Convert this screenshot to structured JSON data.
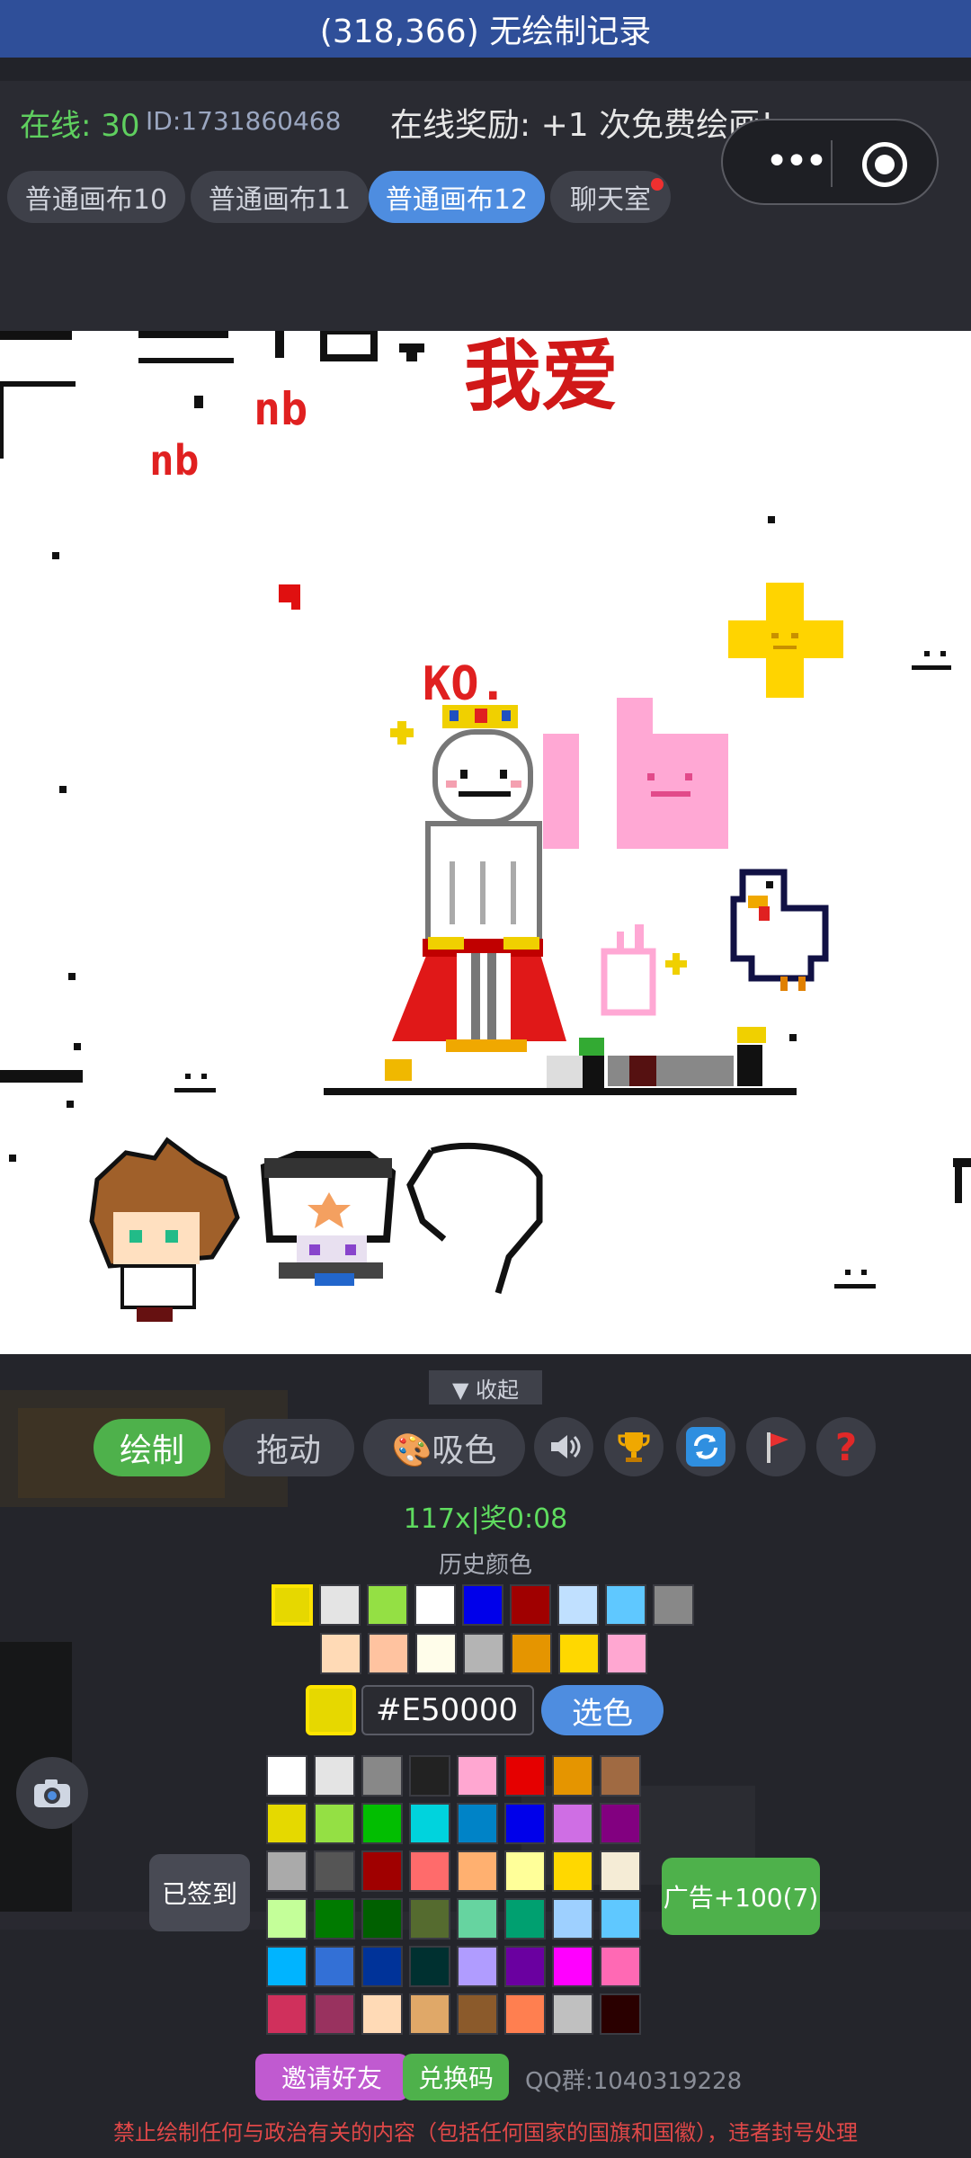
{
  "title": "(318,366) 无绘制记录",
  "info": {
    "online": "在线: 30",
    "user_id": "ID:1731860468",
    "reward": "在线奖励: +1 次免费绘画!"
  },
  "capsule": {
    "more": "•••"
  },
  "tabs": [
    {
      "label": "普通画布10",
      "active": false
    },
    {
      "label": "普通画布11",
      "active": false
    },
    {
      "label": "普通画布12",
      "active": true
    },
    {
      "label": "聊天室",
      "active": false
    }
  ],
  "canvas_text": {
    "nb1": "nb",
    "nb2": "nb",
    "woai": "我爱",
    "ko": "KO."
  },
  "panel": {
    "collapse": "▼ 收起",
    "tools": {
      "draw": "绘制",
      "drag": "拖动",
      "eyedropper": "🎨吸色"
    },
    "icons": [
      "sound-icon",
      "trophy-icon",
      "refresh-icon",
      "flag-icon",
      "help-icon"
    ],
    "timer": "117x|奖0:08",
    "history_title": "历史颜色",
    "history_colors_row1": [
      "#e6d800",
      "#e4e4e4",
      "#94e044",
      "#ffffff",
      "#0000ea",
      "#a00000",
      "#c0e0ff",
      "#5fc8ff",
      "#888888"
    ],
    "history_colors_row2": [
      "#ffdab6",
      "#ffc3a0",
      "#fffdea",
      "#b4b4b4",
      "#e59500",
      "#ffd800",
      "#ffa7d1"
    ],
    "current_color": "#e6d800",
    "hex_value": "#E50000",
    "pick_label": "选色",
    "palette": [
      [
        "#ffffff",
        "#e4e4e4",
        "#888888",
        "#222222",
        "#ffa7d1",
        "#e50000",
        "#e59500",
        "#a06a42"
      ],
      [
        "#e5d900",
        "#94e044",
        "#02be01",
        "#00d3dd",
        "#0083c7",
        "#0000ea",
        "#cf6ee4",
        "#820080"
      ],
      [
        "#aaaaaa",
        "#555555",
        "#a00000",
        "#ff6b6b",
        "#ffb070",
        "#ffff99",
        "#ffd800",
        "#f5ecd6"
      ],
      [
        "#c4ff99",
        "#007a00",
        "#006000",
        "#556b2f",
        "#66d4a0",
        "#00a070",
        "#9ed0ff",
        "#5fc8ff"
      ],
      [
        "#00b4ff",
        "#3370d6",
        "#003399",
        "#003030",
        "#b09cff",
        "#6a00a0",
        "#ff00ff",
        "#ff69b4"
      ],
      [
        "#d0305c",
        "#99325f",
        "#ffdab6",
        "#e0a868",
        "#8b5a2b",
        "#ff7f50",
        "#c0c0c0",
        "#2a0000"
      ]
    ],
    "signed": "已签到",
    "ad": "广告+100(7)",
    "invite": "邀请好友",
    "redeem": "兑换码",
    "qq": "QQ群:1040319228",
    "warning": "禁止绘制任何与政治有关的内容（包括任何国家的国旗和国徽），违者封号处理"
  }
}
